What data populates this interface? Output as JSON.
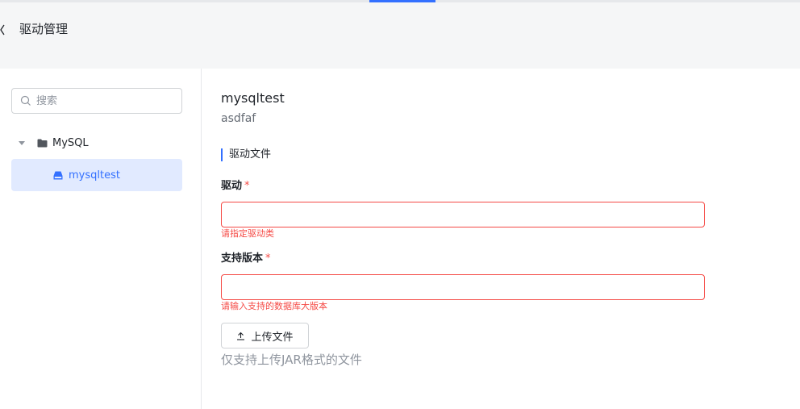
{
  "header": {
    "title": "驱动管理"
  },
  "sidebar": {
    "search": {
      "placeholder": "搜索",
      "value": ""
    },
    "tree": {
      "group_label": "MySQL",
      "item_label": "mysqltest"
    }
  },
  "main": {
    "name": "mysqltest",
    "description": "asdfaf",
    "section_title": "驱动文件",
    "fields": [
      {
        "label": "驱动",
        "required_mark": "*",
        "value": "",
        "error": "请指定驱动类"
      },
      {
        "label": "支持版本",
        "required_mark": "*",
        "value": "",
        "error": "请输入支持的数据库大版本"
      }
    ],
    "upload_label": "上传文件",
    "upload_hint": "仅支持上传JAR格式的文件"
  },
  "colors": {
    "accent": "#3370ff",
    "error": "#f54a45",
    "header_bg": "#f5f6f7"
  },
  "icons": [
    "back-icon",
    "search-icon",
    "caret-down-icon",
    "folder-icon",
    "drive-icon",
    "upload-icon"
  ]
}
